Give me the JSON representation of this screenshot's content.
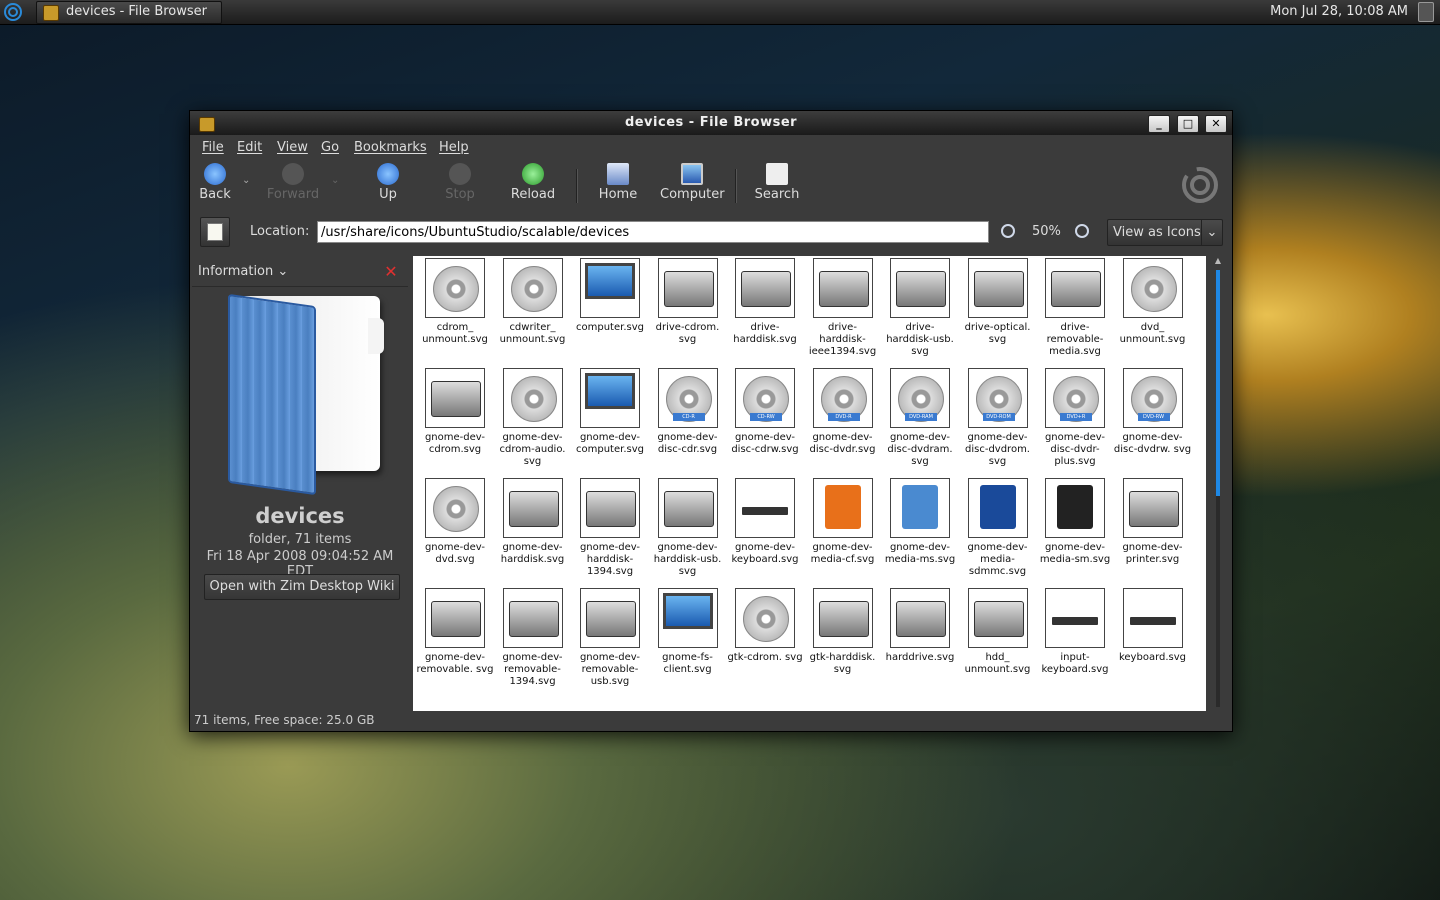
{
  "panel": {
    "task_title": "devices - File Browser",
    "clock": "Mon Jul 28, 10:08 AM"
  },
  "window": {
    "title": "devices - File Browser",
    "controls": {
      "minimize": "_",
      "maximize": "□",
      "close": "✕"
    }
  },
  "menu": [
    "File",
    "Edit",
    "View",
    "Go",
    "Bookmarks",
    "Help"
  ],
  "toolbar": {
    "back": "Back",
    "forward": "Forward",
    "up": "Up",
    "stop": "Stop",
    "reload": "Reload",
    "home": "Home",
    "computer": "Computer",
    "search": "Search"
  },
  "location": {
    "label": "Location:",
    "value": "/usr/share/icons/UbuntuStudio/scalable/devices",
    "zoom": "50%",
    "view_mode": "View as Icons"
  },
  "sidepane": {
    "selector": "Information",
    "name": "devices",
    "type_count": "folder, 71 items",
    "modified": "Fri 18 Apr 2008 09:04:52 AM EDT",
    "open_with": "Open with Zim Desktop Wiki"
  },
  "files": [
    {
      "name": "cdrom_ unmount.svg",
      "kind": "disc"
    },
    {
      "name": "cdwriter_ unmount.svg",
      "kind": "disc"
    },
    {
      "name": "computer.svg",
      "kind": "monitor"
    },
    {
      "name": "drive-cdrom. svg",
      "kind": "drive"
    },
    {
      "name": "drive- harddisk.svg",
      "kind": "drive"
    },
    {
      "name": "drive- harddisk- ieee1394.svg",
      "kind": "drive"
    },
    {
      "name": "drive- harddisk-usb. svg",
      "kind": "drive"
    },
    {
      "name": "drive-optical. svg",
      "kind": "drive"
    },
    {
      "name": "drive- removable- media.svg",
      "kind": "drive"
    },
    {
      "name": "dvd_ unmount.svg",
      "kind": "disc"
    },
    {
      "name": "gnome-dev- cdrom.svg",
      "kind": "drive"
    },
    {
      "name": "gnome-dev- cdrom-audio. svg",
      "kind": "disc"
    },
    {
      "name": "gnome-dev- computer.svg",
      "kind": "monitor"
    },
    {
      "name": "gnome-dev- disc-cdr.svg",
      "kind": "disc",
      "tag": "CD-R"
    },
    {
      "name": "gnome-dev- disc-cdrw.svg",
      "kind": "disc",
      "tag": "CD-RW"
    },
    {
      "name": "gnome-dev- disc-dvdr.svg",
      "kind": "disc",
      "tag": "DVD-R"
    },
    {
      "name": "gnome-dev- disc-dvdram. svg",
      "kind": "disc",
      "tag": "DVD-RAM"
    },
    {
      "name": "gnome-dev- disc-dvdrom. svg",
      "kind": "disc",
      "tag": "DVD-ROM"
    },
    {
      "name": "gnome-dev- disc-dvdr- plus.svg",
      "kind": "disc",
      "tag": "DVD+R"
    },
    {
      "name": "gnome-dev- disc-dvdrw. svg",
      "kind": "disc",
      "tag": "DVD-RW"
    },
    {
      "name": "gnome-dev- dvd.svg",
      "kind": "disc"
    },
    {
      "name": "gnome-dev- harddisk.svg",
      "kind": "drive"
    },
    {
      "name": "gnome-dev- harddisk- 1394.svg",
      "kind": "drive"
    },
    {
      "name": "gnome-dev- harddisk-usb. svg",
      "kind": "drive"
    },
    {
      "name": "gnome-dev- keyboard.svg",
      "kind": "keyboard"
    },
    {
      "name": "gnome-dev- media-cf.svg",
      "kind": "card",
      "color": "#e8701a"
    },
    {
      "name": "gnome-dev- media-ms.svg",
      "kind": "card",
      "color": "#4a8ad0"
    },
    {
      "name": "gnome-dev- media- sdmmc.svg",
      "kind": "card",
      "color": "#1a4a9a"
    },
    {
      "name": "gnome-dev- media-sm.svg",
      "kind": "card",
      "color": "#222222"
    },
    {
      "name": "gnome-dev- printer.svg",
      "kind": "drive"
    },
    {
      "name": "gnome-dev- removable. svg",
      "kind": "drive"
    },
    {
      "name": "gnome-dev- removable- 1394.svg",
      "kind": "drive"
    },
    {
      "name": "gnome-dev- removable- usb.svg",
      "kind": "drive"
    },
    {
      "name": "gnome-fs- client.svg",
      "kind": "monitor"
    },
    {
      "name": "gtk-cdrom. svg",
      "kind": "disc"
    },
    {
      "name": "gtk-harddisk. svg",
      "kind": "drive"
    },
    {
      "name": "harddrive.svg",
      "kind": "drive"
    },
    {
      "name": "hdd_ unmount.svg",
      "kind": "drive"
    },
    {
      "name": "input- keyboard.svg",
      "kind": "keyboard"
    },
    {
      "name": "keyboard.svg",
      "kind": "keyboard"
    }
  ],
  "status": "71 items, Free space: 25.0 GB",
  "colors": {
    "accent": "#1e88e5",
    "close_red": "#e03030"
  }
}
